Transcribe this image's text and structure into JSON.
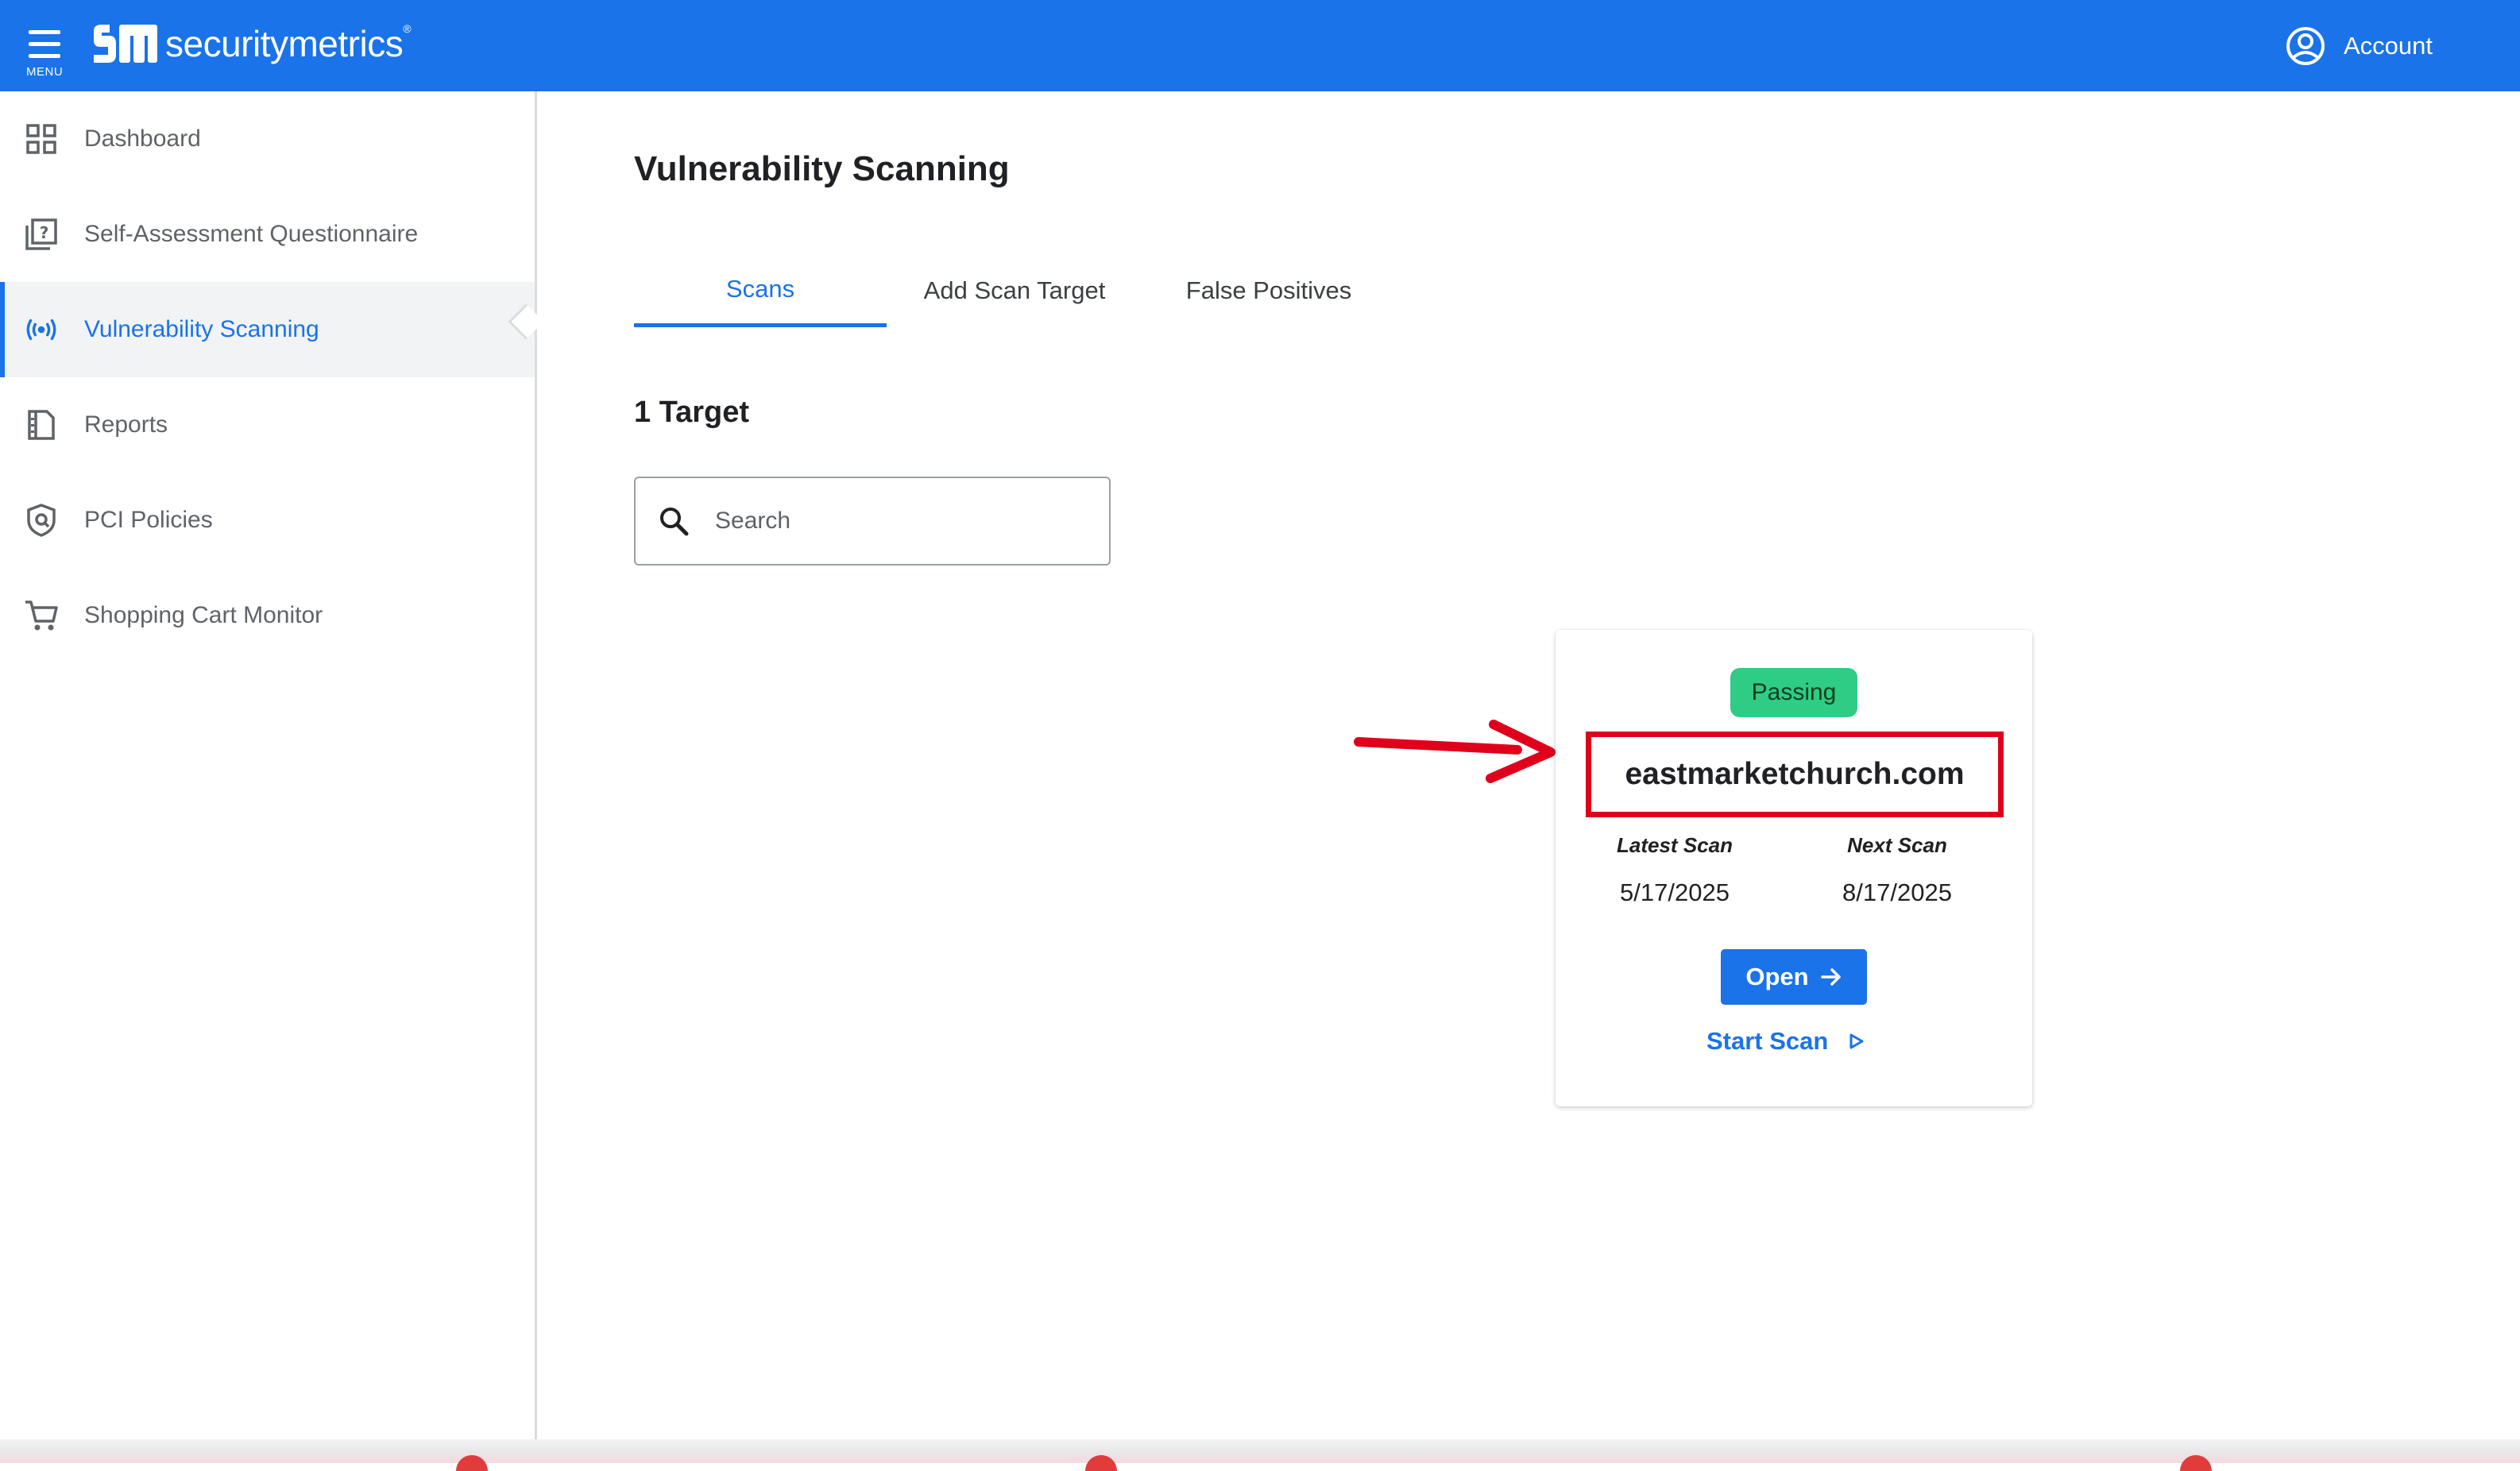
{
  "topbar": {
    "menu_label": "MENU",
    "brand": "securitymetrics",
    "brand_mark": "®",
    "account_label": "Account"
  },
  "sidebar": {
    "items": [
      {
        "label": "Dashboard",
        "icon": "grid-icon"
      },
      {
        "label": "Self-Assessment Questionnaire",
        "icon": "question-doc-icon"
      },
      {
        "label": "Vulnerability Scanning",
        "icon": "radar-icon",
        "active": true
      },
      {
        "label": "Reports",
        "icon": "report-icon"
      },
      {
        "label": "PCI Policies",
        "icon": "shield-icon"
      },
      {
        "label": "Shopping Cart Monitor",
        "icon": "cart-icon"
      }
    ]
  },
  "main": {
    "title": "Vulnerability Scanning",
    "tabs": [
      {
        "label": "Scans",
        "active": true
      },
      {
        "label": "Add Scan Target"
      },
      {
        "label": "False Positives"
      }
    ],
    "target_count": "1 Target",
    "search": {
      "placeholder": "Search",
      "value": ""
    }
  },
  "card": {
    "status": "Passing",
    "domain": "eastmarketchurch.com",
    "latest_scan_label": "Latest Scan",
    "latest_scan_date": "5/17/2025",
    "next_scan_label": "Next Scan",
    "next_scan_date": "8/17/2025",
    "open_label": "Open",
    "start_scan_label": "Start Scan"
  },
  "colors": {
    "accent": "#1a73e8",
    "passing": "#2ecc85",
    "annotation": "#e0001b"
  }
}
